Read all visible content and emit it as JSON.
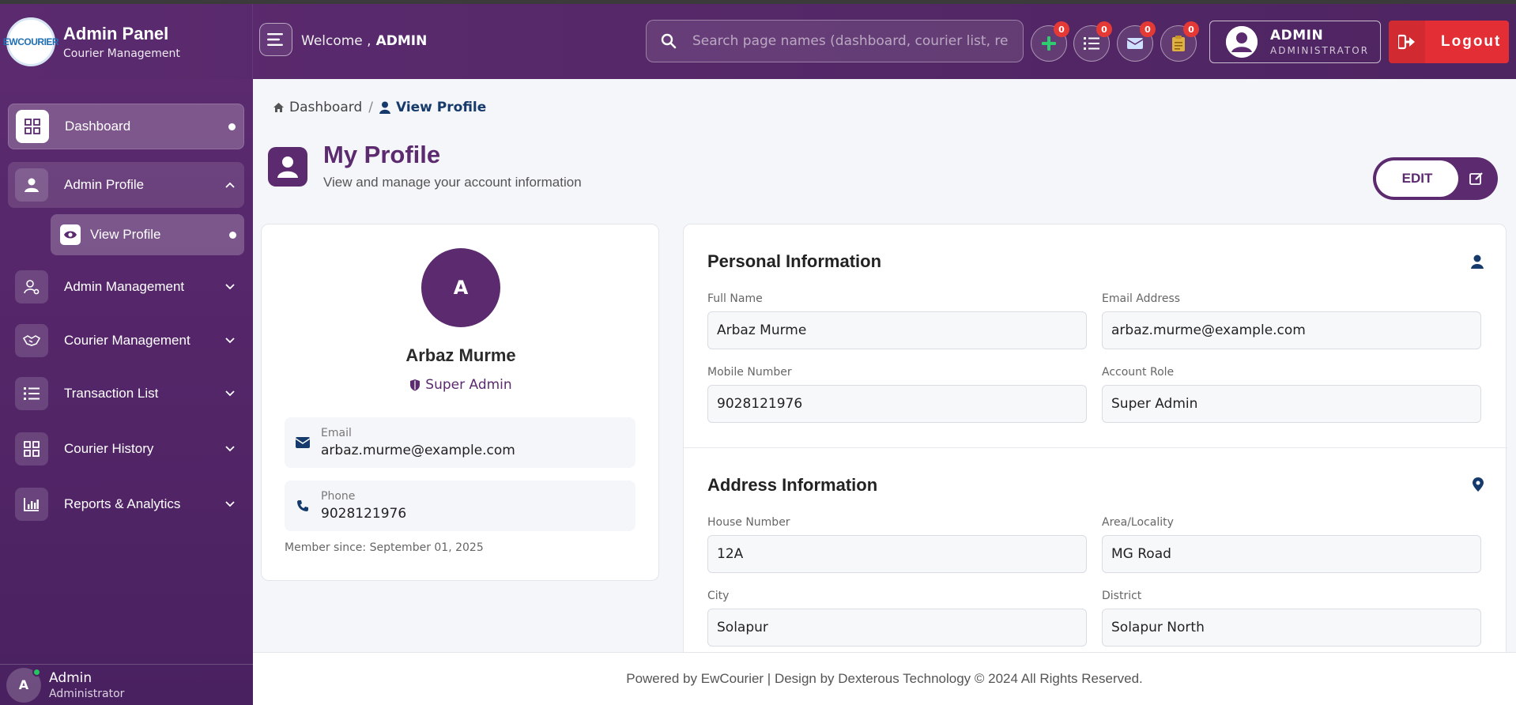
{
  "brand": {
    "title": "Admin Panel",
    "subtitle": "Courier Management",
    "logo_text": "EWCOURIER"
  },
  "header": {
    "welcome_prefix": "Welcome ,",
    "welcome_user": "ADMIN",
    "search_placeholder": "Search page names (dashboard, courier list, reports...)",
    "quick_actions": [
      {
        "icon": "plus-icon",
        "badge": "0"
      },
      {
        "icon": "list-icon",
        "badge": "0"
      },
      {
        "icon": "envelope-icon",
        "badge": "0"
      },
      {
        "icon": "clipboard-icon",
        "badge": "0"
      }
    ],
    "user_name": "ADMIN",
    "user_role": "ADMINISTRATOR",
    "logout_label": "Logout",
    "colors": {
      "header_bg": "#5b2a6f",
      "logout_bg": "#e42e36",
      "badge": "#e53935"
    }
  },
  "sidebar": {
    "items": [
      {
        "label": "Dashboard",
        "icon": "grid-icon",
        "state": "active"
      },
      {
        "label": "Admin Profile",
        "icon": "user-icon",
        "state": "expanded"
      },
      {
        "label": "Admin Management",
        "icon": "user-cog-icon",
        "state": "collapsed"
      },
      {
        "label": "Courier Management",
        "icon": "handshake-icon",
        "state": "collapsed"
      },
      {
        "label": "Transaction List",
        "icon": "list-icon",
        "state": "collapsed"
      },
      {
        "label": "Courier History",
        "icon": "grid-icon",
        "state": "collapsed"
      },
      {
        "label": "Reports & Analytics",
        "icon": "chart-icon",
        "state": "collapsed"
      }
    ],
    "sub_item": {
      "label": "View Profile",
      "icon": "eye-icon"
    },
    "footer": {
      "avatar_letter": "A",
      "name": "Admin",
      "role": "Administrator"
    }
  },
  "breadcrumb": {
    "home": "Dashboard",
    "current": "View Profile"
  },
  "page": {
    "title": "My Profile",
    "subtitle": "View and manage your account information",
    "edit_label": "EDIT"
  },
  "profile": {
    "avatar_letter": "A",
    "name": "Arbaz Murme",
    "role": "Super Admin",
    "email_label": "Email",
    "email": "arbaz.murme@example.com",
    "phone_label": "Phone",
    "phone": "9028121976",
    "member_since": "Member since: September 01, 2025"
  },
  "personal": {
    "title": "Personal Information",
    "full_name_label": "Full Name",
    "full_name": "Arbaz Murme",
    "email_label": "Email Address",
    "email": "arbaz.murme@example.com",
    "mobile_label": "Mobile Number",
    "mobile": "9028121976",
    "role_label": "Account Role",
    "role": "Super Admin"
  },
  "address": {
    "title": "Address Information",
    "house_label": "House Number",
    "house": "12A",
    "area_label": "Area/Locality",
    "area": "MG Road",
    "city_label": "City",
    "city": "Solapur",
    "district_label": "District",
    "district": "Solapur North"
  },
  "footer": {
    "text": "Powered by EwCourier | Design by Dexterous Technology © 2024 All Rights Reserved."
  }
}
